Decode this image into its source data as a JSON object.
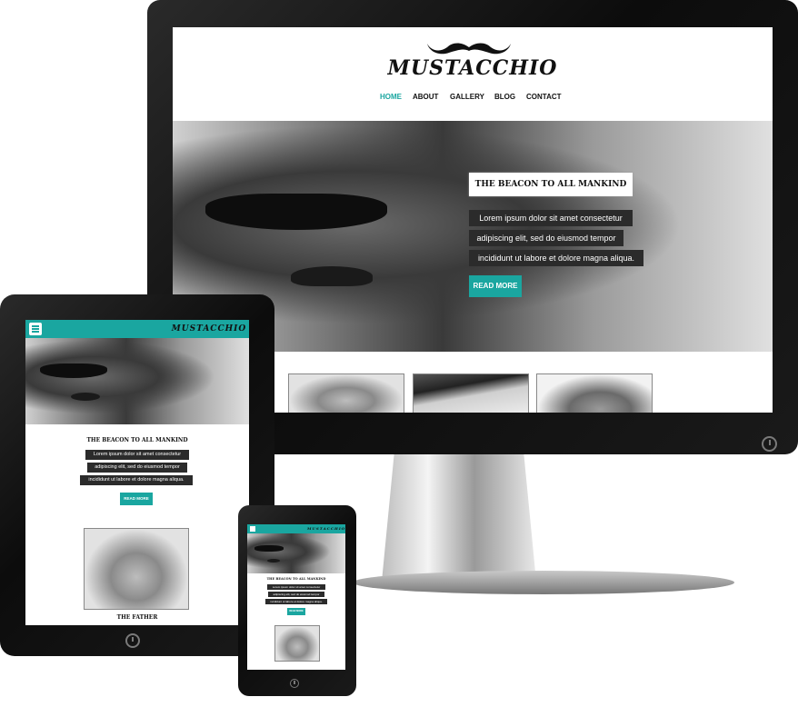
{
  "brand": {
    "logo_text": "MUSTACCHIO"
  },
  "nav": {
    "items": [
      "HOME",
      "ABOUT",
      "GALLERY",
      "BLOG",
      "CONTACT"
    ],
    "active": "HOME",
    "accent": "#1aa6a0"
  },
  "hero": {
    "title": "THE BEACON TO ALL MANKIND",
    "lines": [
      "Lorem ipsum dolor sit amet consectetur",
      "adipiscing elit, sed do eiusmod tempor",
      "incididunt ut labore et dolore magna aliqua."
    ],
    "button": "READ MORE"
  },
  "feature": {
    "caption": "THE FATHER"
  },
  "icons": {
    "menu": "hamburger-icon",
    "power": "power-icon",
    "mustache": "mustache-icon"
  }
}
